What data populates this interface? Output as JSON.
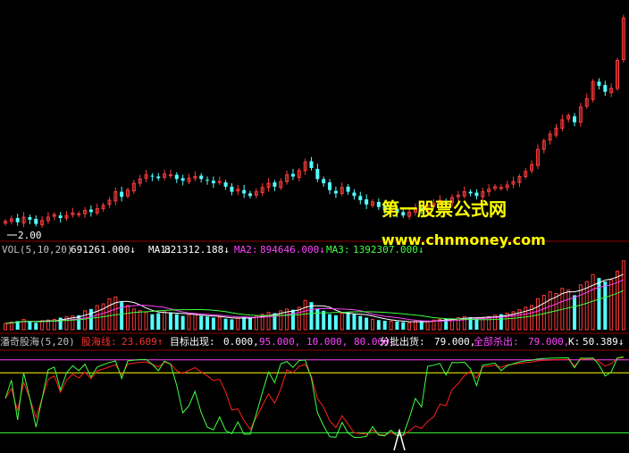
{
  "colors": {
    "background": "#000000",
    "up": "#ff3b3b",
    "down": "#54ffff",
    "white": "#ffffff",
    "yellow": "#ffff00",
    "magenta": "#ff44ff",
    "green": "#40ff40",
    "red": "#ff2020",
    "gray": "#c0c0c0",
    "divider": "#8b0000"
  },
  "price_panel": {
    "low_marker": "2.00"
  },
  "volume_panel": {
    "title": "VOL(5,10,20)",
    "vol_value": "691261.000↓",
    "ma1_label": "MA1:",
    "ma1_value": "821312.188↓",
    "ma2_label": "MA2:",
    "ma2_value": "894646.000↓",
    "ma3_label": "MA3:",
    "ma3_value": "1392307.000↓"
  },
  "indicator_panel": {
    "title": "潘奇股海(5,20)",
    "line_label": "股海线:",
    "line_value": "23.609↑",
    "target_label": "目标出现:",
    "target_values": "0.000,",
    "levels": "95.000, 10.000, 80.000,",
    "sell_batch_label": "分批出货:",
    "sell_batch_value": "79.000,",
    "sell_all_label": "全部杀出:",
    "sell_all_value": "79.000,",
    "k_label": "K:",
    "k_value": "50.389↓"
  },
  "watermark": {
    "line1": "第一股票公式网",
    "line2": "www.chnmoney.com"
  },
  "chart_data": {
    "type": "candlestick",
    "close": [
      2.05,
      2.08,
      2.04,
      2.1,
      2.07,
      2.02,
      2.06,
      2.1,
      2.13,
      2.09,
      2.12,
      2.15,
      2.14,
      2.18,
      2.16,
      2.2,
      2.24,
      2.3,
      2.4,
      2.34,
      2.42,
      2.5,
      2.55,
      2.6,
      2.58,
      2.56,
      2.61,
      2.6,
      2.55,
      2.53,
      2.56,
      2.58,
      2.55,
      2.53,
      2.5,
      2.52,
      2.46,
      2.4,
      2.43,
      2.38,
      2.35,
      2.4,
      2.45,
      2.5,
      2.46,
      2.52,
      2.6,
      2.58,
      2.65,
      2.75,
      2.68,
      2.55,
      2.5,
      2.42,
      2.38,
      2.45,
      2.4,
      2.35,
      2.3,
      2.25,
      2.28,
      2.22,
      2.18,
      2.2,
      2.15,
      2.12,
      2.16,
      2.2,
      2.18,
      2.24,
      2.26,
      2.3,
      2.27,
      2.33,
      2.36,
      2.4,
      2.38,
      2.35,
      2.4,
      2.43,
      2.46,
      2.45,
      2.48,
      2.52,
      2.58,
      2.64,
      2.72,
      2.9,
      3.0,
      3.08,
      3.15,
      3.25,
      3.3,
      3.22,
      3.4,
      3.5,
      3.7,
      3.65,
      3.58,
      3.62,
      3.95,
      4.45
    ],
    "volume": [
      18,
      22,
      25,
      30,
      24,
      20,
      26,
      28,
      30,
      35,
      38,
      40,
      42,
      55,
      60,
      70,
      75,
      90,
      95,
      80,
      70,
      60,
      55,
      50,
      45,
      48,
      52,
      50,
      45,
      40,
      42,
      44,
      40,
      38,
      35,
      36,
      32,
      30,
      34,
      38,
      35,
      40,
      45,
      50,
      48,
      55,
      60,
      58,
      65,
      85,
      80,
      60,
      55,
      45,
      42,
      48,
      50,
      45,
      40,
      35,
      30,
      28,
      26,
      25,
      24,
      22,
      20,
      24,
      26,
      25,
      28,
      30,
      32,
      30,
      35,
      38,
      36,
      34,
      35,
      38,
      42,
      45,
      48,
      52,
      58,
      65,
      70,
      90,
      100,
      110,
      105,
      120,
      115,
      100,
      130,
      140,
      160,
      150,
      140,
      145,
      170,
      200
    ],
    "ma_series": [
      {
        "name": "MA1",
        "value": "821312.188"
      },
      {
        "name": "MA2",
        "value": "894646.000"
      },
      {
        "name": "MA3",
        "value": "1392307.000"
      }
    ],
    "indicator_levels": [
      95,
      10,
      80
    ]
  }
}
